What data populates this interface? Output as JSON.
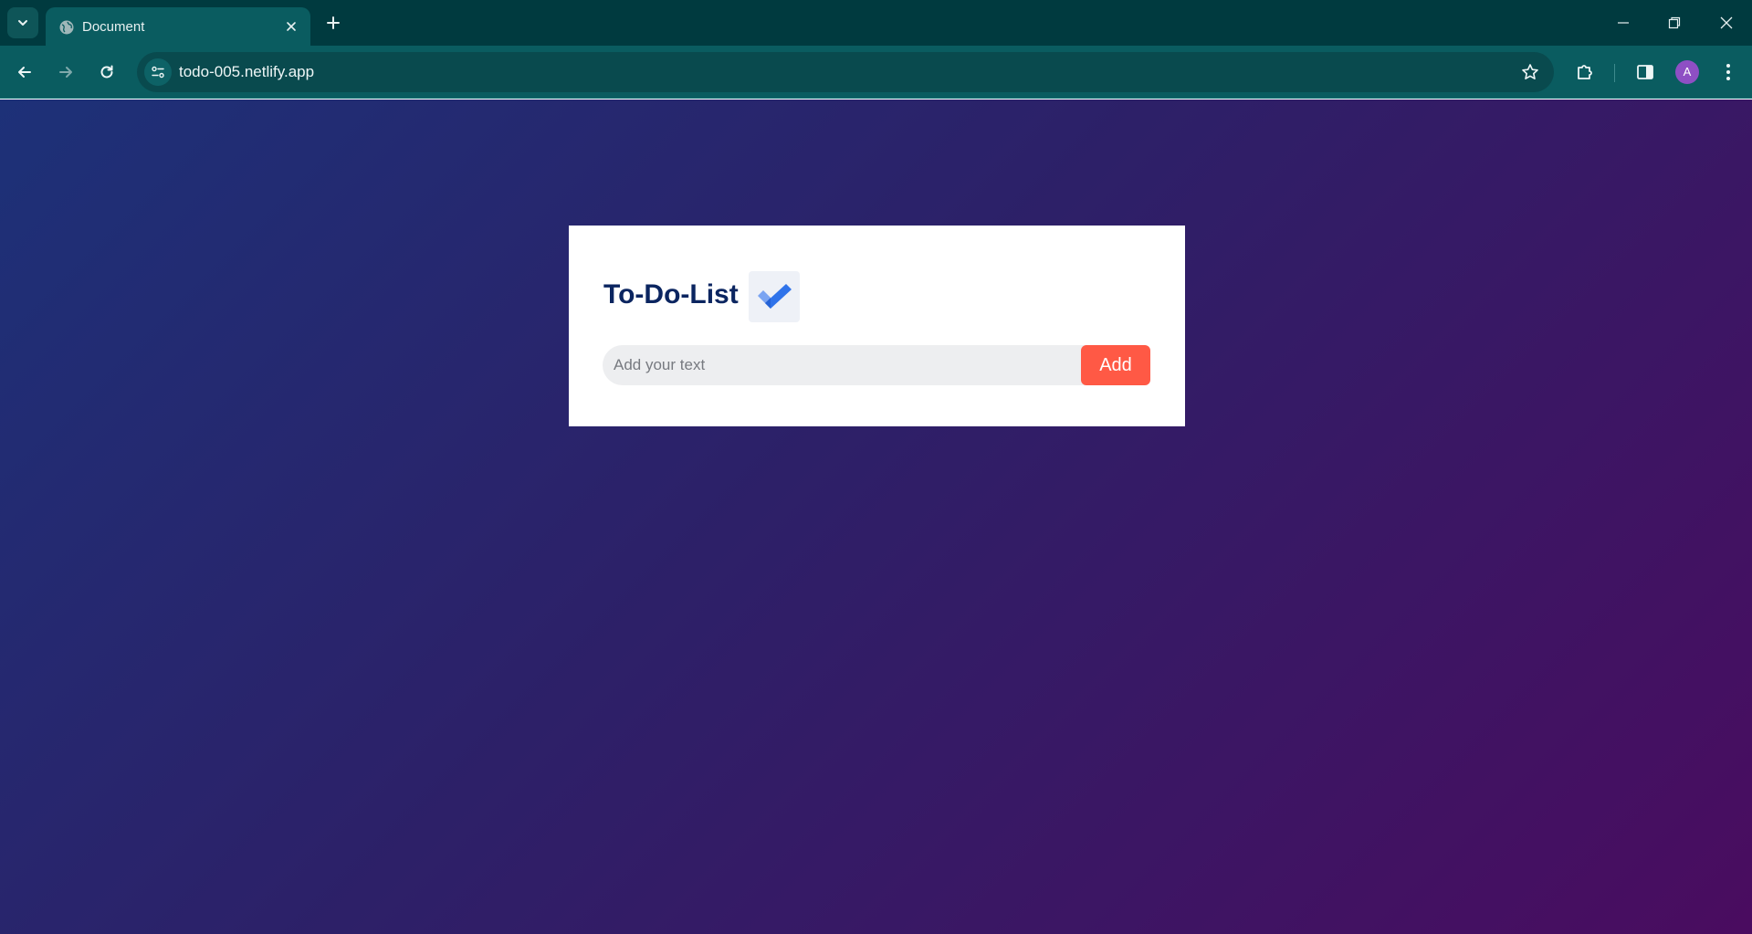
{
  "browser": {
    "tab_title": "Document",
    "url": "todo-005.netlify.app",
    "profile_initial": "A",
    "colors": {
      "tabbar": "#003a3f",
      "toolbar": "#0a5c60",
      "avatar": "#8e4fc4"
    }
  },
  "app": {
    "title": "To-Do-List",
    "title_icon": "checkmark-icon",
    "input": {
      "placeholder": "Add your text",
      "value": ""
    },
    "add_button_label": "Add",
    "colors": {
      "title": "#0b2560",
      "add_button": "#ff5945",
      "input_bg": "#edeef0",
      "background_start": "#1d3178",
      "background_end": "#4a0c60"
    }
  }
}
